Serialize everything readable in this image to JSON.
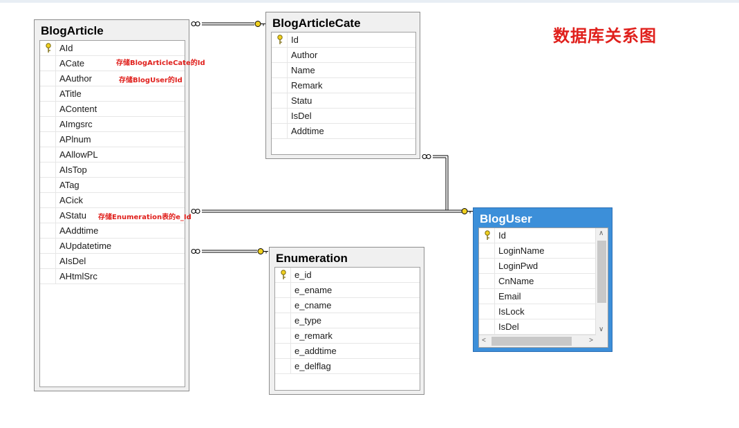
{
  "diagram_title": "数据库关系图",
  "tables": {
    "blog_article": {
      "name": "BlogArticle",
      "fields": [
        "AId",
        "ACate",
        "AAuthor",
        "ATitle",
        "AContent",
        "AImgsrc",
        "APlnum",
        "AAllowPL",
        "AIsTop",
        "ATag",
        "ACick",
        "AStatu",
        "AAddtime",
        "AUpdatetime",
        "AIsDel",
        "AHtmlSrc"
      ]
    },
    "blog_article_cate": {
      "name": "BlogArticleCate",
      "fields": [
        "Id",
        "Author",
        "Name",
        "Remark",
        "Statu",
        "IsDel",
        "Addtime"
      ]
    },
    "enumeration": {
      "name": "Enumeration",
      "fields": [
        "e_id",
        "e_ename",
        "e_cname",
        "e_type",
        "e_remark",
        "e_addtime",
        "e_delflag"
      ]
    },
    "blog_user": {
      "name": "BlogUser",
      "fields": [
        "Id",
        "LoginName",
        "LoginPwd",
        "CnName",
        "Email",
        "IsLock",
        "IsDel"
      ]
    }
  },
  "annotations": {
    "acate_note": "存储BlogArticleCate的Id",
    "aauthor_note": "存储BlogUser的Id",
    "astatu_note": "存储Enumeration表的e_Id"
  },
  "colors": {
    "annotation": "#e0201c",
    "selected_table": "#3c8fd9",
    "key_icon": "#e8c21a"
  },
  "icons": {
    "primary_key": "key-icon",
    "one_end": "key-icon",
    "many_end": "infinity-icon"
  }
}
